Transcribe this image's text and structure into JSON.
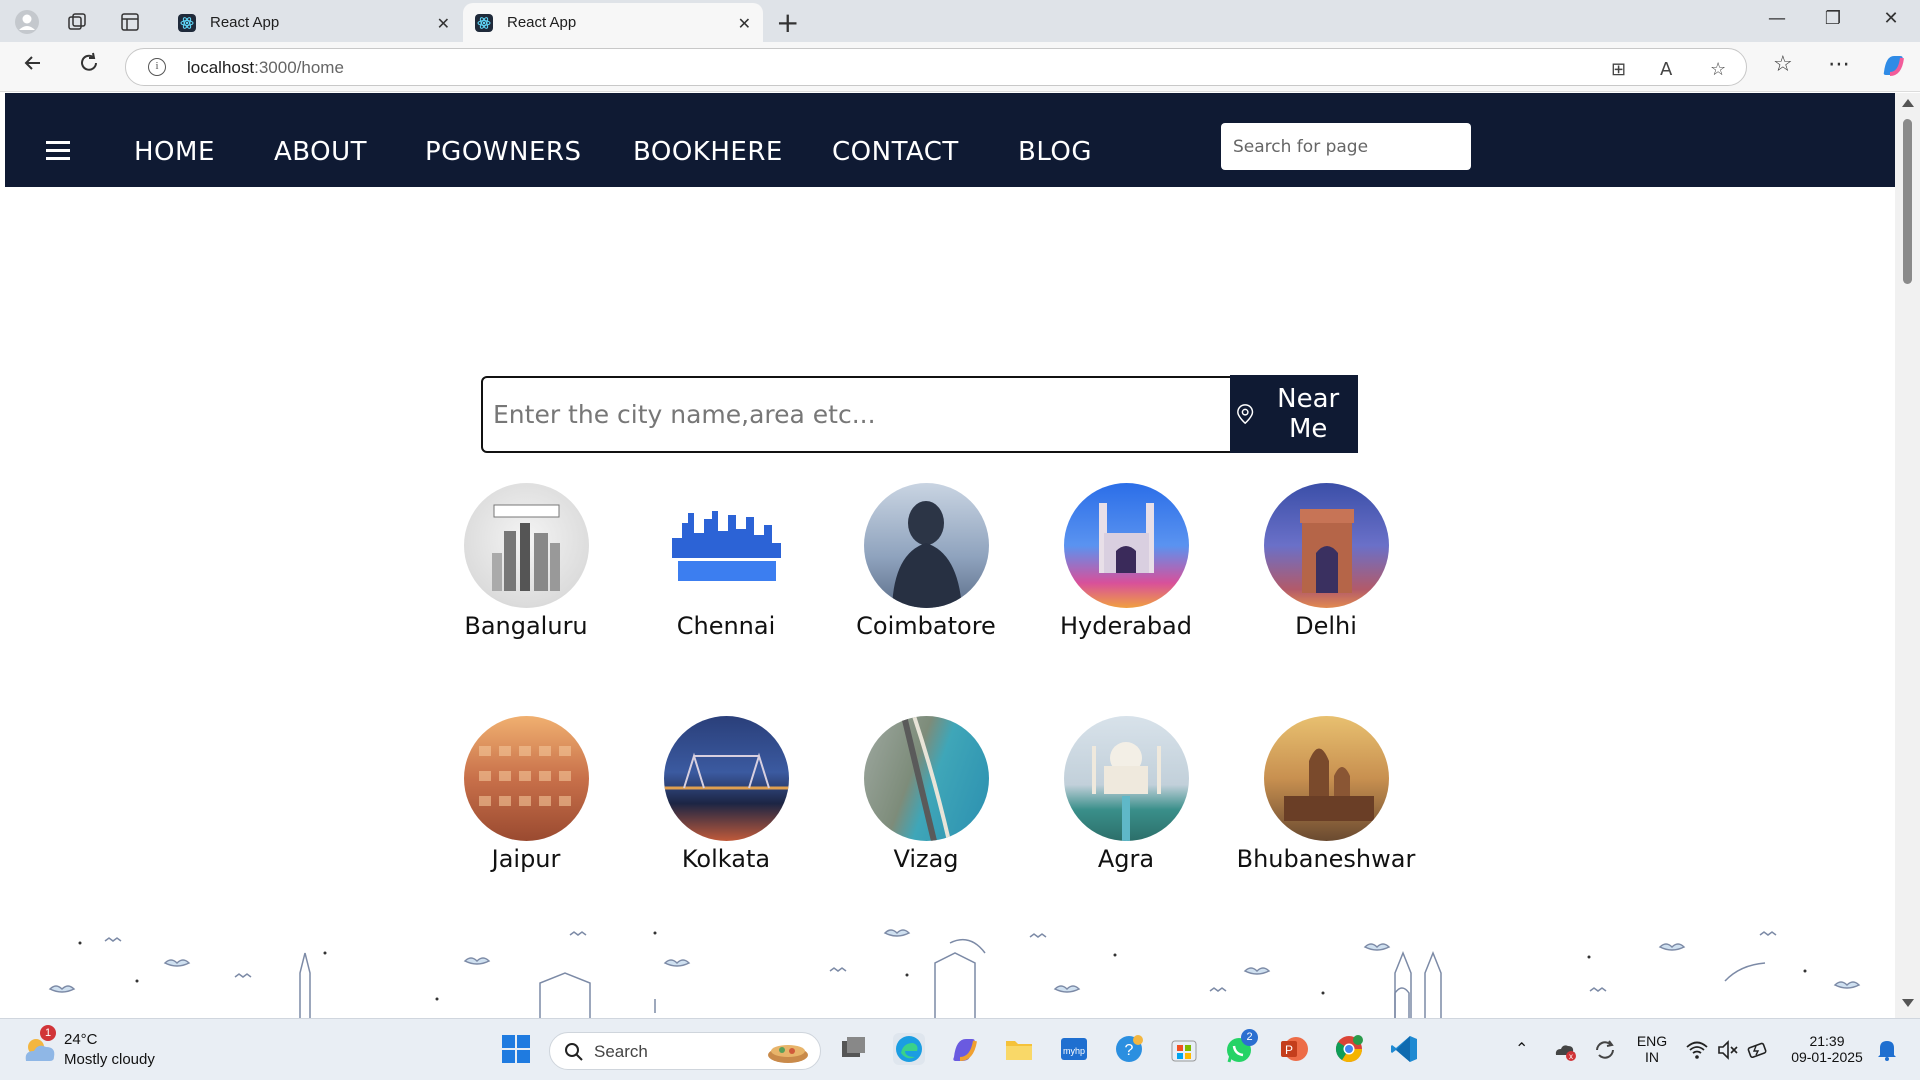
{
  "browser": {
    "tabs": [
      {
        "title": "React App"
      },
      {
        "title": "React App"
      }
    ],
    "url_host": "localhost",
    "url_path": ":3000/home"
  },
  "site": {
    "nav_links": [
      "HOME",
      "ABOUT",
      "PGOWNERS",
      "BOOKHERE",
      "CONTACT",
      "BLOG"
    ],
    "page_search_placeholder": "Search for page",
    "city_search_placeholder": "Enter the city name,area etc...",
    "near_me_label": "Near Me",
    "cities": [
      {
        "name": "Bangaluru"
      },
      {
        "name": "Chennai"
      },
      {
        "name": "Coimbatore"
      },
      {
        "name": "Hyderabad"
      },
      {
        "name": "Delhi"
      },
      {
        "name": "Jaipur"
      },
      {
        "name": "Kolkata"
      },
      {
        "name": "Vizag"
      },
      {
        "name": "Agra"
      },
      {
        "name": "Bhubaneshwar"
      }
    ]
  },
  "taskbar": {
    "weather_temp": "24°C",
    "weather_desc": "Mostly cloudy",
    "weather_badge": "1",
    "search_label": "Search",
    "whatsapp_badge": "2",
    "lang_top": "ENG",
    "lang_bottom": "IN",
    "time": "21:39",
    "date": "09-01-2025"
  }
}
